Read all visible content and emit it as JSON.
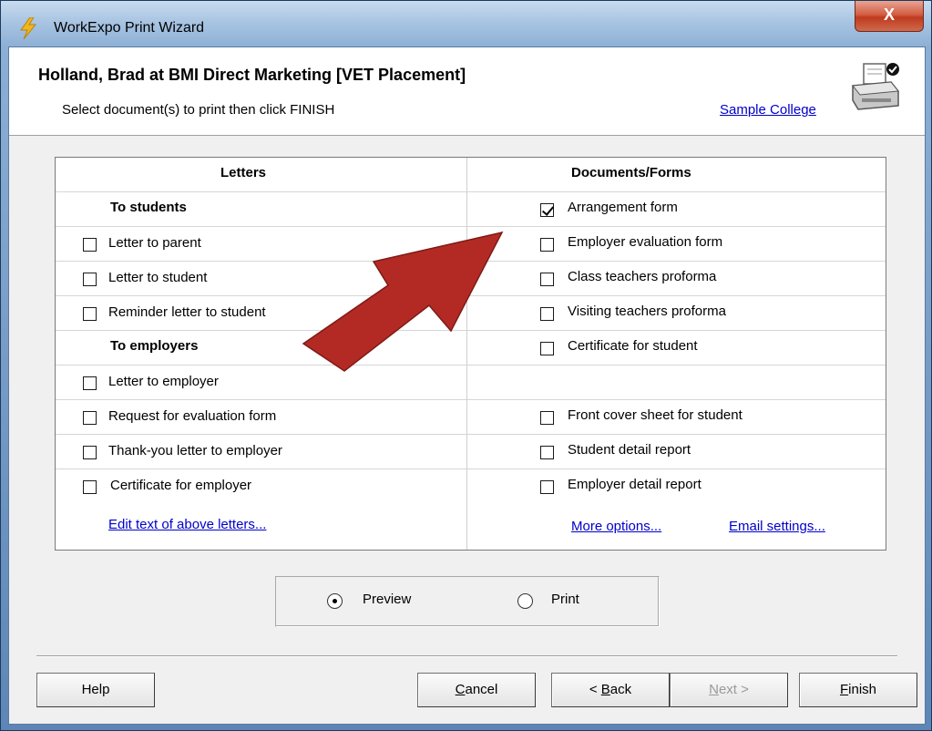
{
  "window": {
    "title": "WorkExpo Print Wizard",
    "close_label": "X"
  },
  "header": {
    "title": "Holland, Brad at BMI Direct Marketing [VET Placement]",
    "subtitle": "Select document(s) to print then click FINISH",
    "college_link": "Sample College"
  },
  "letters": {
    "heading": "Letters",
    "students_heading": "To students",
    "students_items": [
      {
        "label": "Letter to parent",
        "checked": false
      },
      {
        "label": "Letter to student",
        "checked": false
      },
      {
        "label": "Reminder letter to student",
        "checked": false
      }
    ],
    "employers_heading": "To employers",
    "employers_items": [
      {
        "label": "Letter to employer",
        "checked": false
      },
      {
        "label": "Request for evaluation form",
        "checked": false
      },
      {
        "label": "Thank-you letter to employer",
        "checked": false
      },
      {
        "label": "Certificate for employer",
        "checked": false
      }
    ],
    "edit_link": "Edit text of above letters..."
  },
  "documents": {
    "heading": "Documents/Forms",
    "items_top": [
      {
        "label": "Arrangement form",
        "checked": true
      },
      {
        "label": "Employer evaluation form",
        "checked": false
      },
      {
        "label": "Class teachers proforma",
        "checked": false
      },
      {
        "label": "Visiting teachers proforma",
        "checked": false
      },
      {
        "label": "Certificate for student",
        "checked": false
      }
    ],
    "items_bottom": [
      {
        "label": "Front cover sheet for student",
        "checked": false
      },
      {
        "label": "Student detail report",
        "checked": false
      },
      {
        "label": "Employer detail report",
        "checked": false
      }
    ],
    "more_options_link": "More options...",
    "email_settings_link": "Email settings..."
  },
  "output_mode": {
    "preview_label": "Preview",
    "print_label": "Print",
    "selected": "Preview"
  },
  "buttons": {
    "help": "Help",
    "cancel_first": "C",
    "cancel_rest": "ancel",
    "back_pre": "< ",
    "back_first": "B",
    "back_rest": "ack",
    "next_first": "N",
    "next_rest": "ext >",
    "finish_first": "F",
    "finish_rest": "inish"
  },
  "colors": {
    "arrow": "#b32a24",
    "link": "#0000cc",
    "close": "#c9432a"
  }
}
